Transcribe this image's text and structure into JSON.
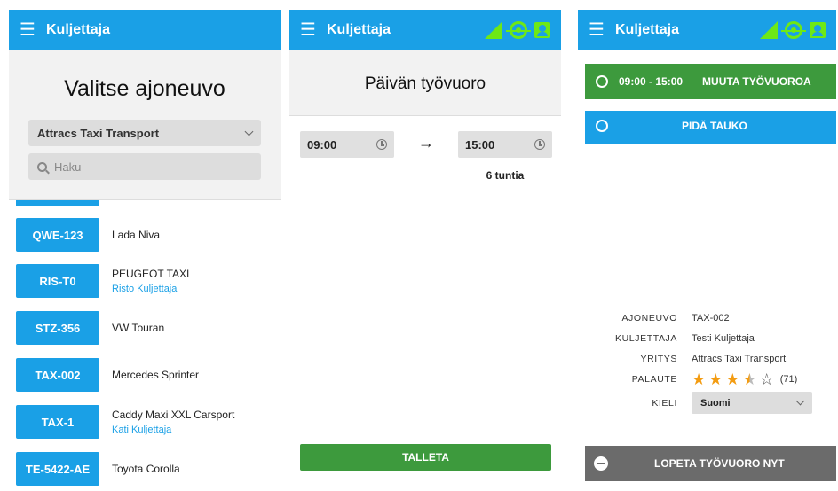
{
  "app": {
    "title": "Kuljettaja"
  },
  "colors": {
    "primary": "#1aa0e6",
    "success": "#3d9a3d",
    "status_ok": "#6ee816",
    "danger_gray": "#6b6b6b",
    "star": "#f39c12"
  },
  "vehicle_select": {
    "heading": "Valitse ajoneuvo",
    "company": "Attracs Taxi Transport",
    "search_placeholder": "Haku",
    "vehicles": [
      {
        "plate": "QWE-123",
        "model": "Lada Niva",
        "driver": ""
      },
      {
        "plate": "RIS-T0",
        "model": "PEUGEOT TAXI",
        "driver": "Risto Kuljettaja"
      },
      {
        "plate": "STZ-356",
        "model": "VW Touran",
        "driver": ""
      },
      {
        "plate": "TAX-002",
        "model": "Mercedes Sprinter",
        "driver": ""
      },
      {
        "plate": "TAX-1",
        "model": "Caddy Maxi XXL Carsport",
        "driver": "Kati Kuljettaja"
      },
      {
        "plate": "TE-5422-AE",
        "model": "Toyota Corolla",
        "driver": ""
      }
    ]
  },
  "shift": {
    "heading": "Päivän työvuoro",
    "start": "09:00",
    "end": "15:00",
    "duration": "6 tuntia",
    "arrow": "→",
    "save_label": "TALLETA"
  },
  "dashboard": {
    "shift_range": "09:00 - 15:00",
    "change_shift_label": "MUUTA TYÖVUOROA",
    "break_label": "PIDÄ TAUKO",
    "labels": {
      "vehicle": "AJONEUVO",
      "driver": "KULJETTAJA",
      "company": "YRITYS",
      "feedback": "PALAUTE",
      "language": "KIELI"
    },
    "vehicle": "TAX-002",
    "driver": "Testi Kuljettaja",
    "company": "Attracs Taxi Transport",
    "rating": 3.5,
    "rating_count": "(71)",
    "language": "Suomi",
    "end_shift_label": "LOPETA TYÖVUORO NYT"
  }
}
